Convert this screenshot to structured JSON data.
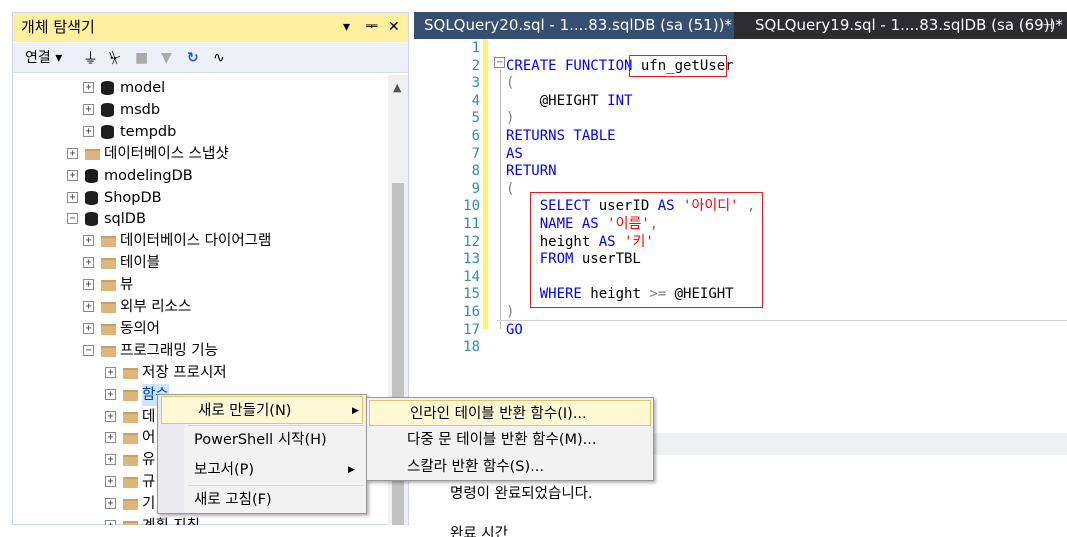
{
  "explorer": {
    "title": "개체 탐색기",
    "title_controls": [
      "▾",
      "ᆍ",
      "✕"
    ],
    "toolbar_connect": "연결",
    "tree": [
      {
        "label": "model",
        "type": "db",
        "level": 3
      },
      {
        "label": "msdb",
        "type": "db",
        "level": 3
      },
      {
        "label": "tempdb",
        "type": "db",
        "level": 3
      },
      {
        "label": "데이터베이스 스냅샷",
        "type": "folder",
        "level": 2
      },
      {
        "label": "modelingDB",
        "type": "db",
        "level": 2
      },
      {
        "label": "ShopDB",
        "type": "db",
        "level": 2
      },
      {
        "label": "sqlDB",
        "type": "db",
        "level": 2,
        "expanded": true
      },
      {
        "label": "데이터베이스 다이어그램",
        "type": "folder",
        "level": 3
      },
      {
        "label": "테이블",
        "type": "folder",
        "level": 3
      },
      {
        "label": "뷰",
        "type": "folder",
        "level": 3
      },
      {
        "label": "외부 리소스",
        "type": "folder",
        "level": 3
      },
      {
        "label": "동의어",
        "type": "folder",
        "level": 3
      },
      {
        "label": "프로그래밍 기능",
        "type": "folder",
        "level": 3,
        "expanded": true
      },
      {
        "label": "저장 프로시저",
        "type": "folder",
        "level": 4
      },
      {
        "label": "함수",
        "type": "folder",
        "level": 4,
        "selected": true
      },
      {
        "label": "데",
        "type": "folder",
        "level": 4
      },
      {
        "label": "어",
        "type": "folder",
        "level": 4
      },
      {
        "label": "유",
        "type": "folder",
        "level": 4
      },
      {
        "label": "규",
        "type": "folder",
        "level": 4
      },
      {
        "label": "기",
        "type": "folder",
        "level": 4
      },
      {
        "label": "계획 지침",
        "type": "folder",
        "level": 4
      }
    ]
  },
  "tabs": [
    {
      "label": "SQLQuery20.sql - 1....83.sqlDB (sa (51))*",
      "active": true
    },
    {
      "label": "SQLQuery19.sql - 1....83.sqlDB (sa (69))*",
      "active": false
    }
  ],
  "editor": {
    "line_numbers": [
      "1",
      "2",
      "3",
      "4",
      "5",
      "6",
      "7",
      "8",
      "9",
      "10",
      "11",
      "12",
      "13",
      "14",
      "15",
      "16",
      "17",
      "18"
    ],
    "lines": [
      {
        "line": 1,
        "parts": []
      },
      {
        "line": 2,
        "parts": [
          {
            "t": "CREATE FUNCTION ",
            "c": "kw"
          },
          {
            "t": "ufn_getUser",
            "c": "bk"
          }
        ]
      },
      {
        "line": 3,
        "parts": [
          {
            "t": "(",
            "c": "gr"
          }
        ]
      },
      {
        "line": 4,
        "parts": [
          {
            "t": "    @HEIGHT ",
            "c": "bk"
          },
          {
            "t": "INT",
            "c": "kw"
          }
        ]
      },
      {
        "line": 5,
        "parts": [
          {
            "t": ")",
            "c": "gr"
          }
        ]
      },
      {
        "line": 6,
        "parts": [
          {
            "t": "RETURNS TABLE",
            "c": "kw"
          }
        ]
      },
      {
        "line": 7,
        "parts": [
          {
            "t": "AS",
            "c": "kw"
          }
        ]
      },
      {
        "line": 8,
        "parts": [
          {
            "t": "RETURN",
            "c": "kw"
          }
        ]
      },
      {
        "line": 9,
        "parts": [
          {
            "t": "(",
            "c": "gr"
          }
        ]
      },
      {
        "line": 10,
        "parts": [
          {
            "t": "    SELECT ",
            "c": "kw"
          },
          {
            "t": "userID ",
            "c": "bk"
          },
          {
            "t": "AS ",
            "c": "kw"
          },
          {
            "t": "'아이디'",
            "c": "str"
          },
          {
            "t": " ,",
            "c": "gr"
          }
        ]
      },
      {
        "line": 11,
        "parts": [
          {
            "t": "    NAME ",
            "c": "kw"
          },
          {
            "t": "AS ",
            "c": "kw"
          },
          {
            "t": "'이름'",
            "c": "str"
          },
          {
            "t": ",",
            "c": "gr"
          }
        ]
      },
      {
        "line": 12,
        "parts": [
          {
            "t": "    height ",
            "c": "bk"
          },
          {
            "t": "AS ",
            "c": "kw"
          },
          {
            "t": "'키'",
            "c": "str"
          }
        ]
      },
      {
        "line": 13,
        "parts": [
          {
            "t": "    FROM ",
            "c": "kw"
          },
          {
            "t": "userTBL",
            "c": "bk"
          }
        ]
      },
      {
        "line": 14,
        "parts": []
      },
      {
        "line": 15,
        "parts": [
          {
            "t": "    WHERE ",
            "c": "kw"
          },
          {
            "t": "height ",
            "c": "bk"
          },
          {
            "t": ">= ",
            "c": "gr"
          },
          {
            "t": "@HEIGHT",
            "c": "bk"
          }
        ]
      },
      {
        "line": 16,
        "parts": [
          {
            "t": ")",
            "c": "gr"
          }
        ]
      },
      {
        "line": 17,
        "parts": [
          {
            "t": "GO",
            "c": "kw"
          }
        ]
      },
      {
        "line": 18,
        "parts": []
      }
    ]
  },
  "results": {
    "message": "명령이 완료되었습니다.",
    "message2": "완료 시간"
  },
  "context_menu": {
    "items": [
      {
        "label": "새로 만들기(N)",
        "submenu": true,
        "selected": true
      },
      {
        "label": "PowerShell 시작(H)",
        "submenu": false
      },
      {
        "label": "보고서(P)",
        "submenu": true
      },
      {
        "label": "새로 고침(F)",
        "submenu": false
      }
    ]
  },
  "submenu": {
    "items": [
      {
        "label": "인라인 테이블 반환 함수(I)...",
        "selected": true
      },
      {
        "label": "다중 문 테이블 반환 함수(M)..."
      },
      {
        "label": "스칼라 반환 함수(S)..."
      }
    ]
  },
  "colors": {
    "accent_tab": "#364e6f",
    "title_bar": "#ffef9f",
    "highlight_box": "#e02020",
    "keyword": "#0000ff",
    "string": "#ff0000"
  }
}
